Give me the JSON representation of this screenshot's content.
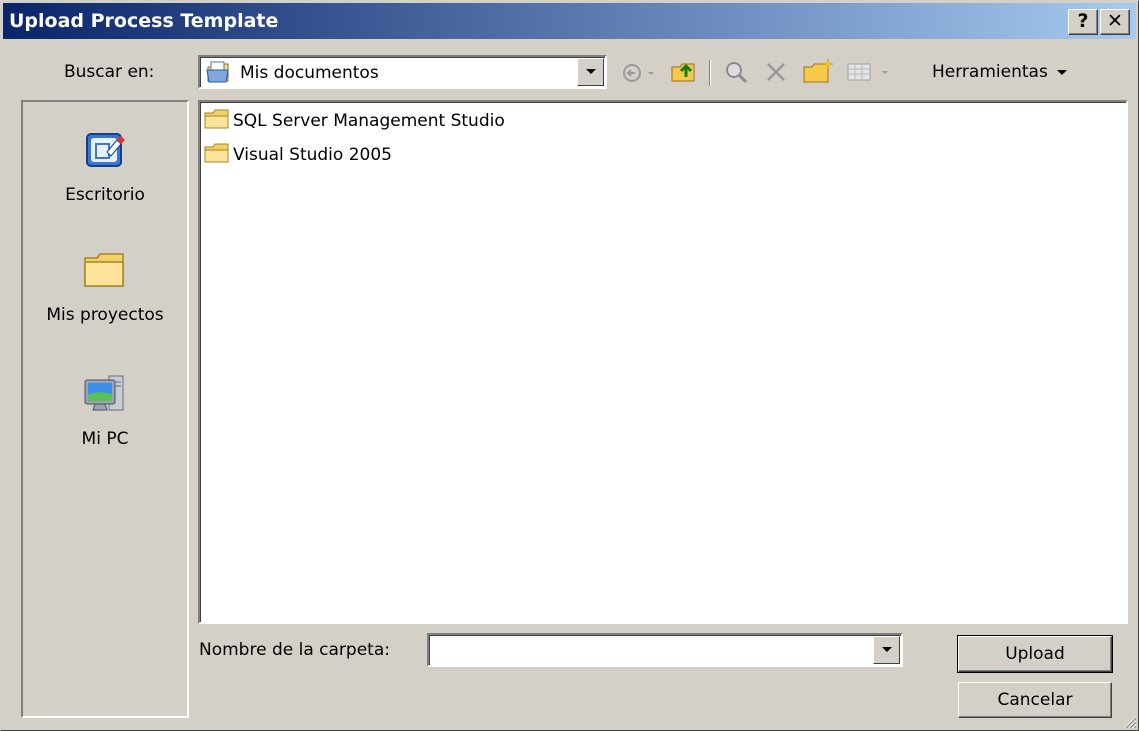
{
  "window": {
    "title": "Upload Process Template",
    "help_button": "?",
    "close_button": "✕"
  },
  "toolbar": {
    "look_in_label": "Buscar en:",
    "look_in_value": "Mis documentos",
    "tools_label": "Herramientas",
    "icons": [
      "back-icon",
      "up-folder-icon",
      "search-web-icon",
      "delete-icon",
      "new-folder-icon",
      "views-icon"
    ]
  },
  "places": [
    {
      "label": "Escritorio",
      "icon": "desktop-icon"
    },
    {
      "label": "Mis proyectos",
      "icon": "folder-icon"
    },
    {
      "label": "Mi PC",
      "icon": "computer-icon"
    }
  ],
  "files": [
    {
      "name": "SQL Server Management Studio",
      "icon": "folder-icon"
    },
    {
      "name": "Visual Studio 2005",
      "icon": "folder-icon"
    }
  ],
  "folder_name": {
    "label": "Nombre de la carpeta:",
    "value": ""
  },
  "buttons": {
    "upload": "Upload",
    "cancel": "Cancelar"
  }
}
